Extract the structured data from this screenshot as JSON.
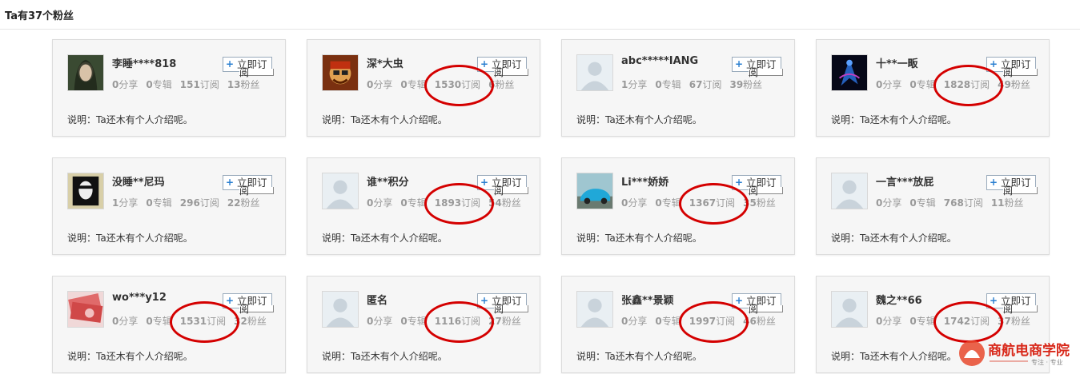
{
  "header": {
    "title": "Ta有37个粉丝"
  },
  "labels": {
    "share": "分享",
    "album": "专辑",
    "subscribe": "订阅",
    "fans": "粉丝",
    "button_line1": "立即订",
    "button_line2": "阅",
    "desc_prefix": "说明：",
    "desc_text": "Ta还木有个人介绍呢。"
  },
  "colors": {
    "circle": "#d40000",
    "accent": "#2a7fd0"
  },
  "users": [
    {
      "name": "李睡****818",
      "avatar": "woman-photo",
      "shares": "0",
      "albums": "0",
      "subs": "151",
      "fans": "13"
    },
    {
      "name": "深*大虫",
      "avatar": "cartoon-pirate",
      "shares": "0",
      "albums": "0",
      "subs": "1530",
      "fans": "6",
      "circled": true
    },
    {
      "name": "abc*****IANG",
      "avatar": "default-avatar",
      "shares": "1",
      "albums": "0",
      "subs": "67",
      "fans": "39"
    },
    {
      "name": "十**一畈",
      "avatar": "blue-dancer",
      "shares": "0",
      "albums": "0",
      "subs": "1828",
      "fans": "49",
      "circled": true
    },
    {
      "name": "没睡**尼玛",
      "avatar": "bw-face",
      "shares": "1",
      "albums": "0",
      "subs": "296",
      "fans": "22"
    },
    {
      "name": "谁**积分",
      "avatar": "default-avatar",
      "shares": "0",
      "albums": "0",
      "subs": "1893",
      "fans": "54",
      "circled": true
    },
    {
      "name": "Li***娇娇",
      "avatar": "blue-car",
      "shares": "0",
      "albums": "0",
      "subs": "1367",
      "fans": "35",
      "circled": true
    },
    {
      "name": "一言***放屁",
      "avatar": "default-avatar",
      "shares": "0",
      "albums": "0",
      "subs": "768",
      "fans": "11"
    },
    {
      "name": "wo***y12",
      "avatar": "money-photo",
      "shares": "0",
      "albums": "0",
      "subs": "1531",
      "fans": "32",
      "circled": true
    },
    {
      "name": "匿名",
      "avatar": "default-avatar",
      "shares": "0",
      "albums": "0",
      "subs": "1116",
      "fans": "27",
      "circled": true
    },
    {
      "name": "张鑫**景颖",
      "avatar": "default-avatar",
      "shares": "0",
      "albums": "0",
      "subs": "1997",
      "fans": "46",
      "circled": true
    },
    {
      "name": "魏之**66",
      "avatar": "default-avatar",
      "shares": "0",
      "albums": "0",
      "subs": "1742",
      "fans": "37",
      "circled": true
    }
  ],
  "watermark": {
    "brand": "商航电商学院",
    "slogan": "专注 · 专业"
  }
}
